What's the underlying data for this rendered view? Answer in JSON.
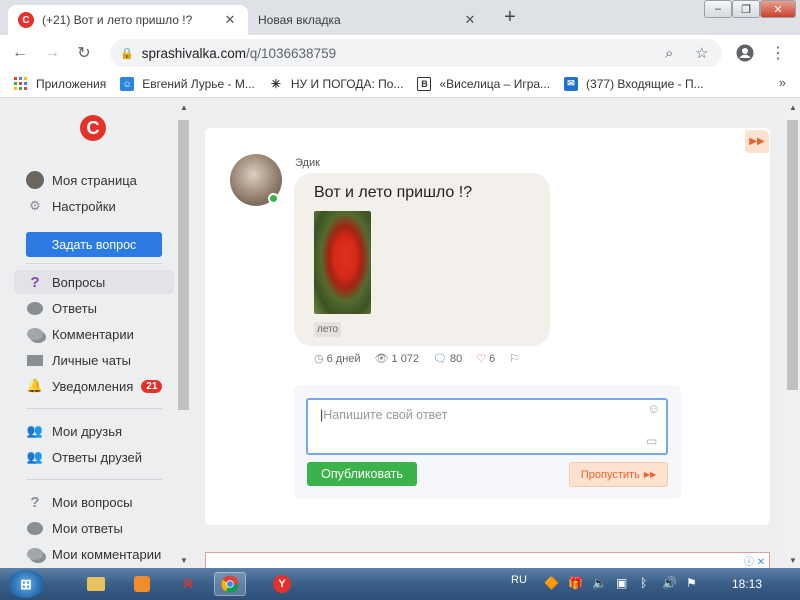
{
  "browser": {
    "tabs": [
      {
        "title": "(+21) Вот и лето пришло !?",
        "active": true
      },
      {
        "title": "Новая вкладка",
        "active": false
      }
    ],
    "url": {
      "host": "sprashivalka.com",
      "path": "/q/1036638759"
    },
    "bookmarks": [
      {
        "label": "Приложения",
        "icon": "apps-grid-icon"
      },
      {
        "label": "Евгений Лурье - М...",
        "icon": "chat-icon"
      },
      {
        "label": "НУ И ПОГОДА: По...",
        "icon": "weather-icon"
      },
      {
        "label": "«Виселица – Игра...",
        "icon": "vk-icon"
      },
      {
        "label": "(377) Входящие - П...",
        "icon": "mail-icon"
      }
    ],
    "more_glyph": "»"
  },
  "sidebar": {
    "logo": "C",
    "profile": [
      {
        "label": "Моя страница",
        "icon": "avatar-icon"
      },
      {
        "label": "Настройки",
        "icon": "gear-icon"
      }
    ],
    "ask_button": "Задать вопрос",
    "nav": [
      {
        "label": "Вопросы",
        "icon": "question-icon",
        "selected": true
      },
      {
        "label": "Ответы",
        "icon": "answer-bubble-icon"
      },
      {
        "label": "Комментарии",
        "icon": "comments-icon"
      },
      {
        "label": "Личные чаты",
        "icon": "envelope-icon"
      },
      {
        "label": "Уведомления",
        "icon": "bell-icon",
        "badge": "21"
      }
    ],
    "friends": [
      {
        "label": "Мои друзья",
        "icon": "friends-icon"
      },
      {
        "label": "Ответы друзей",
        "icon": "friends-answers-icon"
      }
    ],
    "mine": [
      {
        "label": "Мои вопросы",
        "icon": "question-icon"
      },
      {
        "label": "Мои ответы",
        "icon": "answer-bubble-icon"
      },
      {
        "label": "Мои комментарии",
        "icon": "comments-icon"
      }
    ]
  },
  "question": {
    "author": "Эдик",
    "text": "Вот и лето пришло !?",
    "tag": "лето",
    "stats": {
      "age": "6 дней",
      "views": "1 072",
      "comments": "80",
      "likes": "6"
    }
  },
  "answer_form": {
    "placeholder": "Напишите свой ответ",
    "publish_label": "Опубликовать",
    "skip_label": "Пропустить"
  },
  "taskbar": {
    "language": "RU",
    "clock": "18:13"
  },
  "colors": {
    "brand_red": "#e4322b",
    "ask_blue": "#2c7be5",
    "publish_green": "#3bb34a",
    "skip_orange": "#e8642c"
  }
}
